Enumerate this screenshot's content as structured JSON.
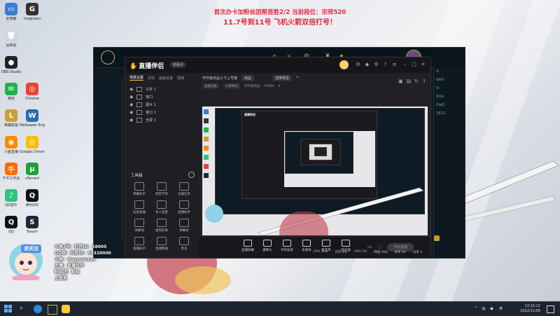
{
  "overlay": {
    "line1": "首次办卡加粉丝团帮首胜2/2   当前段位：宗师520",
    "line2": "11.7号到11号 飞机火箭双倍打号！"
  },
  "desktop_icons": [
    {
      "name": "此电脑",
      "color": "#3a7bd5",
      "glyph": "▭"
    },
    {
      "name": "回收站",
      "color": "#cfd3da",
      "glyph": "🗑"
    },
    {
      "name": "OBS Studio",
      "color": "#222",
      "glyph": "●"
    },
    {
      "name": "微信",
      "color": "#22b14c",
      "glyph": "✉"
    },
    {
      "name": "英雄联盟",
      "color": "#c9a03a",
      "glyph": "L"
    },
    {
      "name": "斗鱼直播",
      "color": "#ff8a00",
      "glyph": "◉"
    },
    {
      "name": "千牛工作台",
      "color": "#ff6a00",
      "glyph": "千"
    },
    {
      "name": "QQ音乐",
      "color": "#31c27c",
      "glyph": "♪"
    },
    {
      "name": "magicasu",
      "color": "#333",
      "glyph": "G"
    },
    {
      "name": "Chrome",
      "color": "#e94235",
      "glyph": "◎"
    },
    {
      "name": "Wallpaper Engine",
      "color": "#2b6cb0",
      "glyph": "W"
    },
    {
      "name": "Google Chrome",
      "color": "#fbbc05",
      "glyph": "◎"
    },
    {
      "name": "uTorrent",
      "color": "#1fa03a",
      "glyph": "μ"
    },
    {
      "name": "腾讯QQ",
      "color": "#111",
      "glyph": "Q"
    },
    {
      "name": "Steam",
      "color": "#1b2838",
      "glyph": "S"
    },
    {
      "name": "QQ",
      "color": "#111",
      "glyph": "Q"
    }
  ],
  "stream_app": {
    "logo": "直播伴侣",
    "version": "新版本",
    "sidebar_tabs": [
      "场景设置",
      "添加",
      "画面设置",
      "插播"
    ],
    "scenes": [
      "文本 1",
      "窗口",
      "图片 1",
      "窗口 1",
      "全屏 1"
    ],
    "tools_title": "工具箱",
    "tools": [
      "弹幕助手",
      "便签节目",
      "主播任务",
      "投屏直播",
      "多人连麦",
      "直播助手",
      "弹幕墙",
      "虚拟形象",
      "弹幕屏",
      "看播助手",
      "直播数据",
      "更多"
    ],
    "title": "作作金商品小卡上号继",
    "title_chip": "商品",
    "category_chip": "选择类型",
    "info": [
      "画面设置",
      "大屏模式",
      "作作金商品",
      "54080",
      "4"
    ],
    "bottom_buttons": [
      "直播屏幕",
      "摄像头",
      "手机投屏",
      "多媒体",
      "麦克风",
      "扬声器"
    ],
    "start_live": "开始直播"
  },
  "streamer": {
    "follow": "求关注",
    "lines": [
      "斗鱼3号：抖音ID：58000",
      "QQ群：抖音ID：58320000",
      "斗鱼：douyuzuzuo",
      "主播：直播伙伴",
      "粉丝团：粉丝",
      "上联系"
    ]
  },
  "status_strip": [
    "CPU 11%",
    "内存 8%",
    "GPU 5%",
    "网络 0KB",
    "帧率 60",
    "码率 0"
  ],
  "game_right_panel": [
    "Q",
    "QeQ",
    "Q",
    "Only",
    "QwQ",
    "1813"
  ],
  "taskbar": {
    "lang": "英",
    "time": "13:32:12",
    "date": "2022/11/06"
  }
}
